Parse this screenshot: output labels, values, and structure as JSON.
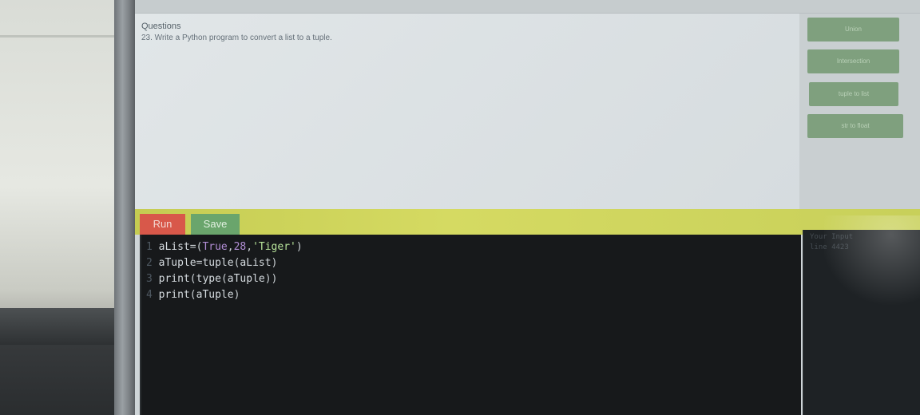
{
  "question": {
    "heading": "Questions",
    "text": "23. Write a Python program to convert a list to a tuple."
  },
  "snippets": [
    {
      "label": "Union"
    },
    {
      "label": "Intersection"
    },
    {
      "label": "tuple to list"
    },
    {
      "label": "str to float"
    }
  ],
  "toolbar": {
    "run_label": "Run",
    "save_label": "Save"
  },
  "editor": {
    "lines": [
      {
        "num": "1",
        "parts": [
          [
            "aList",
            "var"
          ],
          [
            "=",
            "op"
          ],
          [
            "(",
            "op"
          ],
          [
            "True",
            "kw"
          ],
          [
            ",",
            "op"
          ],
          [
            "28",
            "num"
          ],
          [
            ",",
            "op"
          ],
          [
            "'Tiger'",
            "str"
          ],
          [
            ")",
            "op"
          ]
        ]
      },
      {
        "num": "2",
        "parts": [
          [
            "aTuple",
            "var"
          ],
          [
            "=",
            "op"
          ],
          [
            "tuple",
            "fn"
          ],
          [
            "(",
            "op"
          ],
          [
            "aList",
            "var"
          ],
          [
            ")",
            "op"
          ]
        ]
      },
      {
        "num": "3",
        "parts": [
          [
            "print",
            "fn"
          ],
          [
            "(",
            "op"
          ],
          [
            "type",
            "fn"
          ],
          [
            "(",
            "op"
          ],
          [
            "aTuple",
            "var"
          ],
          [
            ")",
            "op"
          ],
          [
            ")",
            "op"
          ]
        ]
      },
      {
        "num": "4",
        "parts": [
          [
            "print",
            "fn"
          ],
          [
            "(",
            "op"
          ],
          [
            "aTuple",
            "var"
          ],
          [
            ")",
            "op"
          ]
        ]
      }
    ]
  },
  "output": {
    "lines": [
      "Your Input",
      "line 4423"
    ]
  },
  "colors": {
    "run": "#d8584a",
    "save": "#6aa56c",
    "toolbar": "#d5da62",
    "snippet": "#7fa07e"
  }
}
